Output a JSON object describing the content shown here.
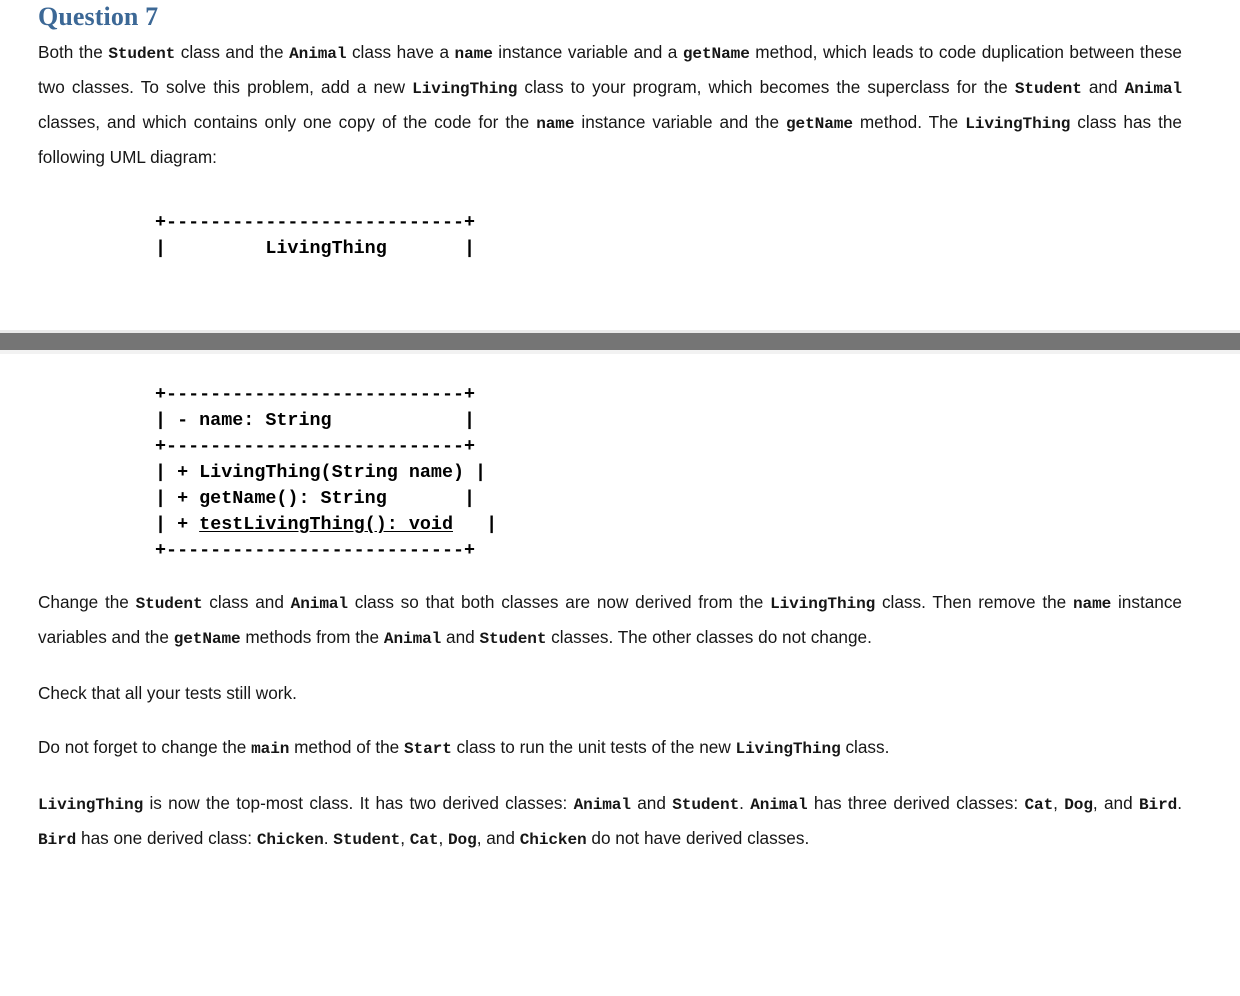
{
  "document": {
    "heading": "Question 7",
    "heading_color": "#3c6896",
    "divider_color": "#757575",
    "paragraph_1": {
      "segments": [
        {
          "text": "Both the ",
          "style": "normal"
        },
        {
          "text": "Student",
          "style": "code"
        },
        {
          "text": " class and the ",
          "style": "normal"
        },
        {
          "text": "Animal",
          "style": "code"
        },
        {
          "text": " class have a ",
          "style": "normal"
        },
        {
          "text": "name",
          "style": "code"
        },
        {
          "text": " instance variable and a ",
          "style": "normal"
        },
        {
          "text": "getName",
          "style": "code"
        },
        {
          "text": " method, which leads to code duplication between these two classes. To solve this problem, add a new ",
          "style": "normal"
        },
        {
          "text": "LivingThing",
          "style": "code"
        },
        {
          "text": " class to your program, which becomes the superclass for the ",
          "style": "normal"
        },
        {
          "text": "Student",
          "style": "code"
        },
        {
          "text": " and ",
          "style": "normal"
        },
        {
          "text": "Animal",
          "style": "code"
        },
        {
          "text": " classes, and which contains only one copy of the code for the ",
          "style": "normal"
        },
        {
          "text": "name",
          "style": "code"
        },
        {
          "text": " instance variable and the ",
          "style": "normal"
        },
        {
          "text": "getName",
          "style": "code"
        },
        {
          "text": " method. The ",
          "style": "normal"
        },
        {
          "text": "LivingThing",
          "style": "code"
        },
        {
          "text": " class has the following UML diagram:",
          "style": "normal"
        }
      ]
    },
    "uml_top": "+---------------------------+\n|         LivingThing       |",
    "uml_bottom": {
      "line_1": "+---------------------------+",
      "line_2": "| - name: String            |",
      "line_3": "+---------------------------+",
      "line_4": "| + LivingThing(String name) |",
      "line_5": "| + getName(): String       |",
      "line_6_prefix": "| + ",
      "line_6_underlined": "testLivingThing(): void",
      "line_6_suffix": "   |",
      "line_7": "+---------------------------+"
    },
    "paragraph_2": {
      "segments": [
        {
          "text": "Change the ",
          "style": "normal"
        },
        {
          "text": "Student",
          "style": "code"
        },
        {
          "text": " class and ",
          "style": "normal"
        },
        {
          "text": "Animal",
          "style": "code"
        },
        {
          "text": " class so that both classes are now derived from the ",
          "style": "normal"
        },
        {
          "text": "LivingThing",
          "style": "code"
        },
        {
          "text": " class. Then remove the ",
          "style": "normal"
        },
        {
          "text": "name",
          "style": "code"
        },
        {
          "text": " instance variables and the ",
          "style": "normal"
        },
        {
          "text": "getName",
          "style": "code"
        },
        {
          "text": " methods from the ",
          "style": "normal"
        },
        {
          "text": "Animal",
          "style": "code"
        },
        {
          "text": " and ",
          "style": "normal"
        },
        {
          "text": "Student",
          "style": "code"
        },
        {
          "text": " classes. The other classes do not change.",
          "style": "normal"
        }
      ]
    },
    "paragraph_3": {
      "segments": [
        {
          "text": "Check that all your tests still work.",
          "style": "normal"
        }
      ]
    },
    "paragraph_4": {
      "segments": [
        {
          "text": "Do not forget to change the ",
          "style": "normal"
        },
        {
          "text": "main",
          "style": "code"
        },
        {
          "text": " method of the ",
          "style": "normal"
        },
        {
          "text": "Start",
          "style": "code"
        },
        {
          "text": " class to run the unit tests of the new ",
          "style": "normal"
        },
        {
          "text": "LivingThing",
          "style": "code"
        },
        {
          "text": " class.",
          "style": "normal"
        }
      ]
    },
    "paragraph_5": {
      "segments": [
        {
          "text": "LivingThing",
          "style": "code"
        },
        {
          "text": " is now the top-most class. It has two derived classes: ",
          "style": "normal"
        },
        {
          "text": "Animal",
          "style": "code"
        },
        {
          "text": " and ",
          "style": "normal"
        },
        {
          "text": "Student",
          "style": "code"
        },
        {
          "text": ". ",
          "style": "normal"
        },
        {
          "text": "Animal",
          "style": "code"
        },
        {
          "text": " has three derived classes: ",
          "style": "normal"
        },
        {
          "text": "Cat",
          "style": "code"
        },
        {
          "text": ", ",
          "style": "normal"
        },
        {
          "text": "Dog",
          "style": "code"
        },
        {
          "text": ", and ",
          "style": "normal"
        },
        {
          "text": "Bird",
          "style": "code"
        },
        {
          "text": ". ",
          "style": "normal"
        },
        {
          "text": "Bird",
          "style": "code"
        },
        {
          "text": " has one derived class: ",
          "style": "normal"
        },
        {
          "text": "Chicken",
          "style": "code"
        },
        {
          "text": ". ",
          "style": "normal"
        },
        {
          "text": "Student",
          "style": "code"
        },
        {
          "text": ", ",
          "style": "normal"
        },
        {
          "text": "Cat",
          "style": "code"
        },
        {
          "text": ", ",
          "style": "normal"
        },
        {
          "text": "Dog",
          "style": "code"
        },
        {
          "text": ", and ",
          "style": "normal"
        },
        {
          "text": "Chicken",
          "style": "code"
        },
        {
          "text": " do not have derived classes.",
          "style": "normal"
        }
      ]
    }
  }
}
